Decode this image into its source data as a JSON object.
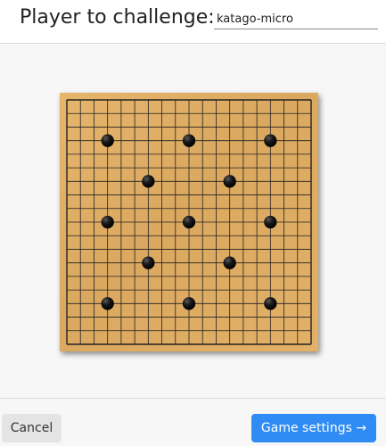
{
  "header": {
    "label": "Player to challenge:",
    "player_value": "katago-micro"
  },
  "board": {
    "size": 19,
    "colors": {
      "wood": "#dcaa62",
      "line": "#222222",
      "stone_black": "#111111"
    },
    "handicap_stones": [
      {
        "col": 3,
        "row": 3,
        "color": "black"
      },
      {
        "col": 9,
        "row": 3,
        "color": "black"
      },
      {
        "col": 15,
        "row": 3,
        "color": "black"
      },
      {
        "col": 6,
        "row": 6,
        "color": "black"
      },
      {
        "col": 12,
        "row": 6,
        "color": "black"
      },
      {
        "col": 3,
        "row": 9,
        "color": "black"
      },
      {
        "col": 9,
        "row": 9,
        "color": "black"
      },
      {
        "col": 15,
        "row": 9,
        "color": "black"
      },
      {
        "col": 6,
        "row": 12,
        "color": "black"
      },
      {
        "col": 12,
        "row": 12,
        "color": "black"
      },
      {
        "col": 3,
        "row": 15,
        "color": "black"
      },
      {
        "col": 9,
        "row": 15,
        "color": "black"
      },
      {
        "col": 15,
        "row": 15,
        "color": "black"
      }
    ]
  },
  "footer": {
    "cancel_label": "Cancel",
    "settings_label": "Game settings →",
    "settings_color": "#2f8cf5"
  }
}
